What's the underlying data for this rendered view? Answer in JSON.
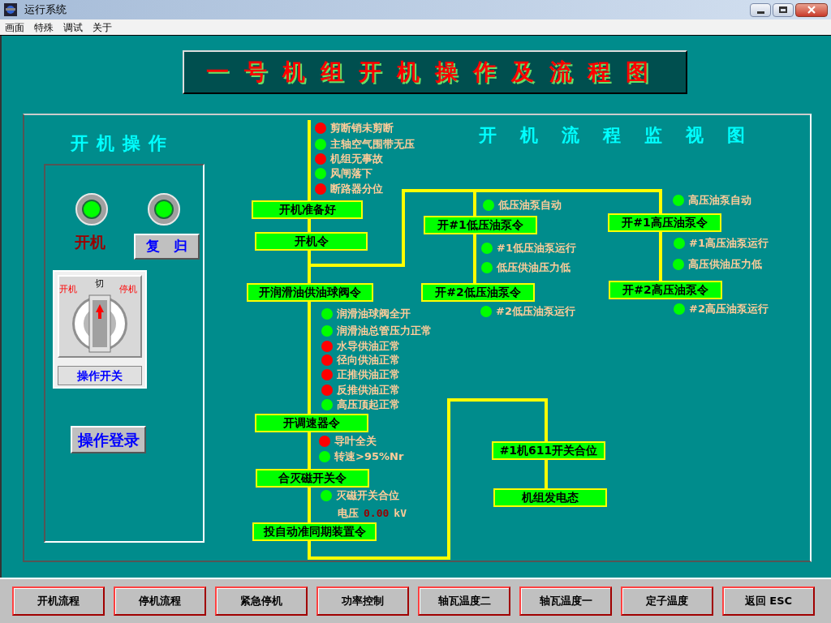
{
  "window": {
    "title": "运行系统",
    "menu": [
      "画面",
      "特殊",
      "调试",
      "关于"
    ]
  },
  "banner": {
    "title": "一号机组开机操作及流程图"
  },
  "operation_panel": {
    "title": "开机操作",
    "lamps": [
      {
        "on": true
      },
      {
        "on": true
      }
    ],
    "start_label": "开机",
    "reset_button": "复　归",
    "switch": {
      "positions": [
        {
          "label": "开机",
          "selected": false
        },
        {
          "label": "切",
          "selected": true
        },
        {
          "label": "停机",
          "selected": false
        }
      ],
      "caption": "操作开关"
    },
    "login_button": "操作登录"
  },
  "flow": {
    "title": "开机流程监视图",
    "commands": [
      "开机准备好",
      "开机令",
      "开润滑油供油球阀令",
      "开调速器令",
      "合灭磁开关令",
      "投自动准同期装置令",
      "开#1低压油泵令",
      "开#2低压油泵令",
      "开#1高压油泵令",
      "开#2高压油泵令",
      "#1机611开关合位",
      "机组发电态"
    ],
    "indicators": [
      {
        "label": "剪断销未剪断",
        "color": "#ff0000"
      },
      {
        "label": "主轴空气围带无压",
        "color": "#00ff00"
      },
      {
        "label": "机组无事故",
        "color": "#ff0000"
      },
      {
        "label": "风闸落下",
        "color": "#00ff00"
      },
      {
        "label": "断路器分位",
        "color": "#ff0000"
      },
      {
        "label": "润滑油球阀全开",
        "color": "#00ff00"
      },
      {
        "label": "润滑油总管压力正常",
        "color": "#00ff00"
      },
      {
        "label": "水导供油正常",
        "color": "#ff0000"
      },
      {
        "label": "径向供油正常",
        "color": "#ff0000"
      },
      {
        "label": "正推供油正常",
        "color": "#ff0000"
      },
      {
        "label": "反推供油正常",
        "color": "#ff0000"
      },
      {
        "label": "高压顶起正常",
        "color": "#00ff00"
      },
      {
        "label": "导叶全关",
        "color": "#ff0000"
      },
      {
        "label": "转速>95%Nr",
        "color": "#00ff00"
      },
      {
        "label": "灭磁开关合位",
        "color": "#00ff00"
      },
      {
        "label": "低压油泵自动",
        "color": "#00ff00"
      },
      {
        "label": "#1低压油泵运行",
        "color": "#00ff00"
      },
      {
        "label": "低压供油压力低",
        "color": "#00ff00"
      },
      {
        "label": "#2低压油泵运行",
        "color": "#00ff00"
      },
      {
        "label": "高压油泵自动",
        "color": "#00ff00"
      },
      {
        "label": "#1高压油泵运行",
        "color": "#00ff00"
      },
      {
        "label": "高压供油压力低",
        "color": "#00ff00"
      },
      {
        "label": "#2高压油泵运行",
        "color": "#00ff00"
      }
    ],
    "voltage": {
      "label": "电压",
      "value": "0.00",
      "unit": "kV"
    }
  },
  "bottom_buttons": [
    "开机流程",
    "停机流程",
    "紧急停机",
    "功率控制",
    "轴瓦温度二",
    "轴瓦温度一",
    "定子温度",
    "返回 ESC"
  ]
}
